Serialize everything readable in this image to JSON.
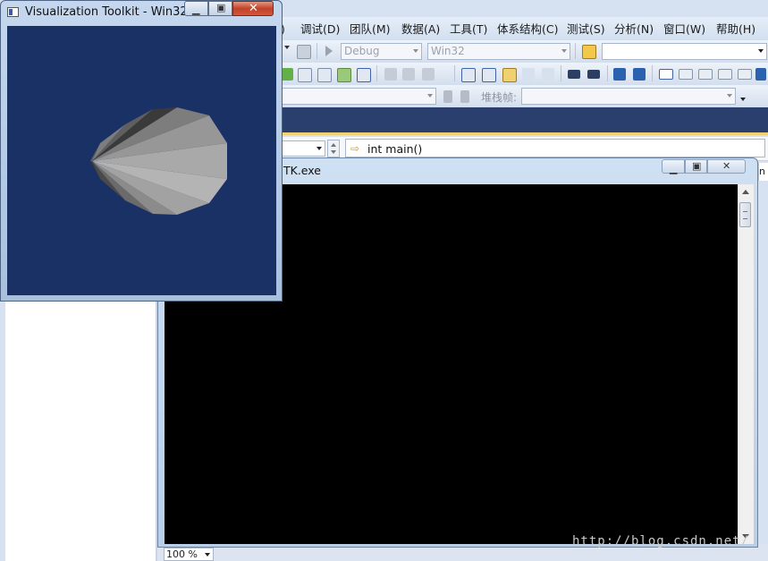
{
  "vs": {
    "menu": [
      {
        "label": ")"
      },
      {
        "label": "调试(D)"
      },
      {
        "label": "团队(M)"
      },
      {
        "label": "数据(A)"
      },
      {
        "label": "工具(T)"
      },
      {
        "label": "体系结构(C)"
      },
      {
        "label": "测试(S)"
      },
      {
        "label": "分析(N)"
      },
      {
        "label": "窗口(W)"
      },
      {
        "label": "帮助(H)"
      }
    ],
    "toolbar": {
      "config_value": "Debug",
      "platform_value": "Win32",
      "stack_frame_label": "堆栈帧:"
    },
    "editor": {
      "function_value": "int main()"
    },
    "statusbar": {
      "zoom_value": "100 %"
    },
    "right_tab_text": "n"
  },
  "console": {
    "title": "TK.exe"
  },
  "vtk_window": {
    "title": "Visualization Toolkit - Win32...",
    "background_color": "#1a3166",
    "shape_colors": [
      "#3a3a3a",
      "#5f5f5f",
      "#7d7d7d",
      "#979797",
      "#a9a9a9",
      "#b4b4b4",
      "#a2a2a2",
      "#8b8b8b",
      "#6b6b6b",
      "#4a4a4a"
    ]
  },
  "watermark": "http://blog.csdn.net/"
}
